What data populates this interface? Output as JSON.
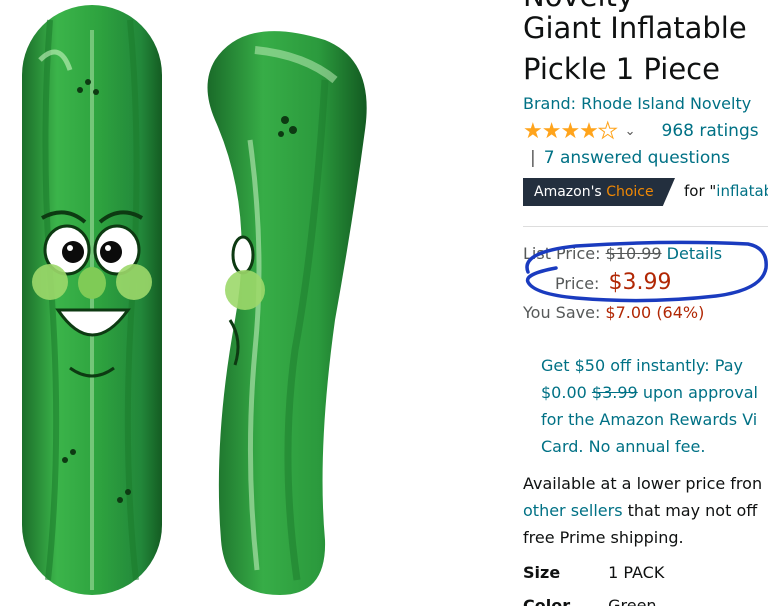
{
  "product": {
    "title_top_fragment": "Novelty",
    "title_line1": "Giant Inflatable",
    "title_line2": "Pickle 1 Piece",
    "brand": "Brand: Rhode Island Novelty",
    "rating_stars": 4.5,
    "ratings_count": "968 ratings",
    "answered_questions": "7 answered questions",
    "choice_badge_prefix": "Amazon's",
    "choice_badge_suffix": "Choice",
    "choice_for_prefix": "for \"",
    "choice_keyword": "inflatable"
  },
  "pricing": {
    "list_price_label": "List Price:",
    "list_price_value": "$10.99",
    "details_link": "Details",
    "price_label": "Price:",
    "price_value": "$3.99",
    "you_save_label": "You Save:",
    "you_save_value": "$7.00 (64%)"
  },
  "offer": {
    "line1": "Get $50 off instantly: Pay",
    "line2_prefix": "$0.00",
    "line2_strike": "$3.99",
    "line2_suffix": "upon approval",
    "line3": "for the Amazon Rewards Vi",
    "line4": "Card. No annual fee."
  },
  "availability": {
    "line1": "Available at a lower price fron",
    "line2_link": "other sellers",
    "line2_rest": "that may not off",
    "line3": "free Prime shipping."
  },
  "specs": [
    {
      "label": "Size",
      "value": "1 PACK"
    },
    {
      "label": "Color",
      "value": "Green"
    }
  ],
  "colors": {
    "link": "#007185",
    "price": "#B12704",
    "star": "#FFA41C",
    "badge": "#232F3E",
    "annotation_circle": "#1a3bbf",
    "pickle_green": "#2e9b3a"
  }
}
